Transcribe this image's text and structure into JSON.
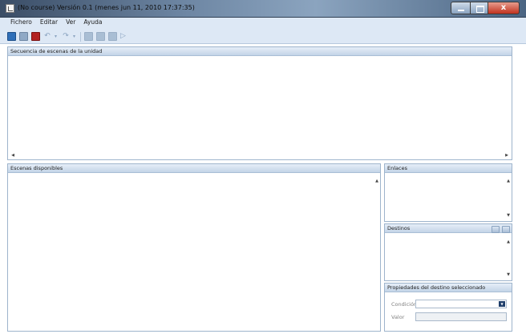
{
  "window": {
    "title": "(No course) Versión 0.1 (menes jun 11, 2010 17:37:35)",
    "close_glyph": "x"
  },
  "menu": {
    "items": [
      "Fichero",
      "Editar",
      "Ver",
      "Ayuda"
    ]
  },
  "toolbar": {
    "icons": [
      "open-icon",
      "save-icon",
      "stop-icon",
      "undo-icon",
      "redo-icon",
      "scene-icon",
      "scene-icon",
      "scene-icon",
      "play-icon"
    ],
    "arrow_glyph": "↶",
    "redo_glyph": "↷",
    "caret_glyph": "▾",
    "play_glyph": "▷"
  },
  "panels": {
    "sequence": {
      "title": "Secuencia de escenas de la unidad"
    },
    "available": {
      "title": "Escenas disponibles"
    },
    "links": {
      "title": "Enlaces"
    },
    "destinations": {
      "title": "Destinos"
    },
    "properties": {
      "title": "Propiedades del destino seleccionado",
      "condition_label": "Condición",
      "value_label": "Valor"
    }
  },
  "scroll_glyphs": {
    "up": "▲",
    "down": "▼",
    "left": "◀",
    "right": "▶",
    "combo": "▼"
  },
  "colors": {
    "accent": "#c3d4e7",
    "border": "#9eb4cc",
    "close": "#c1321f"
  }
}
